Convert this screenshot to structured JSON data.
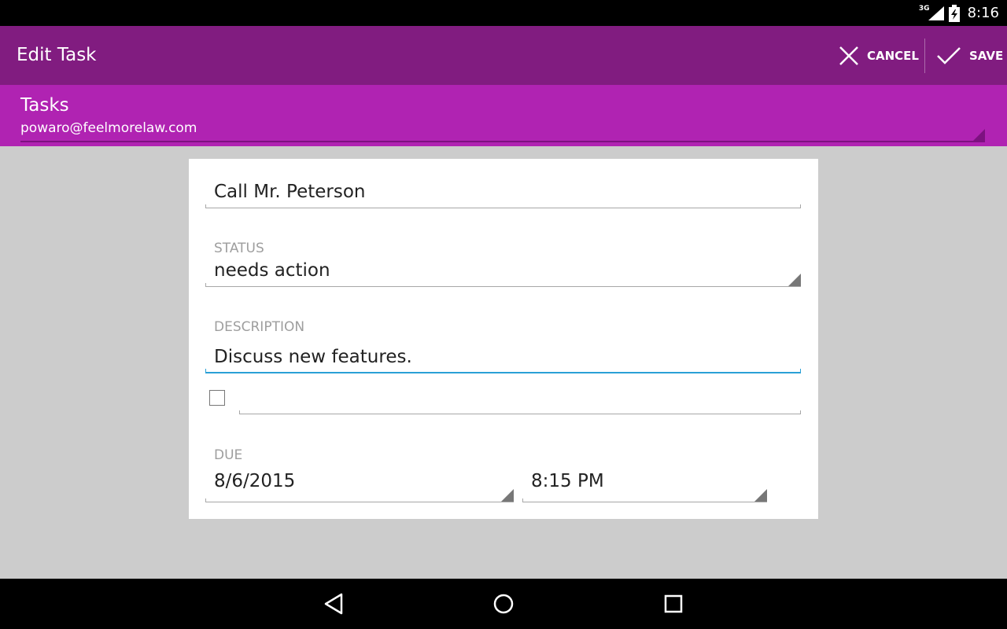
{
  "status_bar": {
    "network": "3G",
    "time": "8:16",
    "icons": [
      "signal-icon",
      "battery-charging-icon"
    ]
  },
  "action_bar": {
    "title": "Edit Task",
    "cancel_label": "CANCEL",
    "save_label": "SAVE",
    "icons": [
      "close-icon",
      "checkmark-icon"
    ],
    "color": "#811c80"
  },
  "account": {
    "title": "Tasks",
    "email": "powaro@feelmorelaw.com",
    "color": "#b023b2"
  },
  "form": {
    "title_value": "Call Mr. Peterson",
    "status_label": "STATUS",
    "status_value": "needs action",
    "description_label": "DESCRIPTION",
    "description_value": "Discuss new features.",
    "checklist_item_value": "",
    "checklist_checked": false,
    "due_label": "DUE",
    "due_date": "8/6/2015",
    "due_time": "8:15 PM",
    "focus_color": "#2aa0d6"
  },
  "nav_bar": {
    "icons": [
      "back-icon",
      "home-icon",
      "recents-icon"
    ]
  }
}
